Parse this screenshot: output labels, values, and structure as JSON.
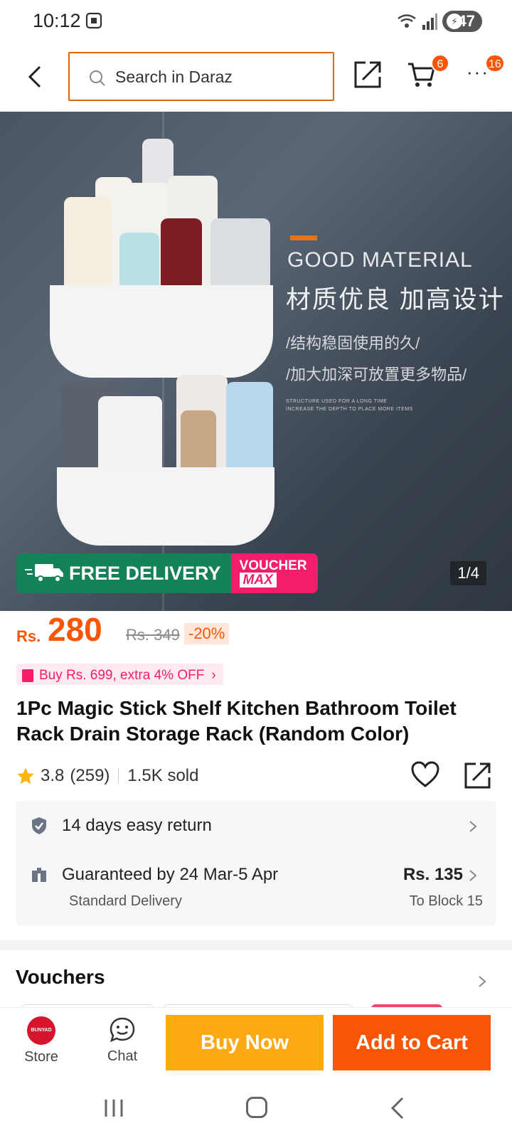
{
  "status_bar": {
    "time": "10:12",
    "battery": "47"
  },
  "header": {
    "search_placeholder": "Search in Daraz",
    "cart_count": "6",
    "more_count": "16"
  },
  "gallery": {
    "heading_en": "GOOD MATERIAL",
    "heading_cn": "材质优良 加高设计",
    "line1": "/结构稳固使用的久/",
    "line2": "/加大加深可放置更多物品/",
    "fine1": "STRUCTURE USED FOR A LONG TIME",
    "fine2": "INCREASE THE DEPTH TO PLACE MORE ITEMS",
    "free_delivery": "FREE DELIVERY",
    "voucher_1": "VOUCHER",
    "voucher_2": "MAX",
    "counter": "1/4"
  },
  "price": {
    "currency": "Rs.",
    "amount": "280",
    "original": "Rs. 349",
    "discount": "-20%"
  },
  "offer_text": "Buy Rs. 699, extra 4% OFF",
  "product_title": "1Pc Magic Stick Shelf Kitchen Bathroom Toilet Rack Drain Storage Rack (Random Color)",
  "rating": {
    "score": "3.8",
    "reviews": "(259)",
    "sold": "1.5K sold"
  },
  "service": {
    "return_text": "14 days easy return",
    "delivery_text": "Guaranteed by 24 Mar-5 Apr",
    "delivery_type": "Standard Delivery",
    "delivery_fee": "Rs. 135",
    "delivery_location": "To Block 15"
  },
  "vouchers_heading": "Vouchers",
  "actions": {
    "store_label": "Store",
    "store_logo_text": "BUNYAD",
    "chat_label": "Chat",
    "buy_now": "Buy Now",
    "add_to_cart": "Add to Cart"
  },
  "colors": {
    "brand_orange": "#f85606",
    "buy_now_yellow": "#fea914",
    "voucher_pink": "#f21e6c",
    "free_green": "#158158"
  }
}
